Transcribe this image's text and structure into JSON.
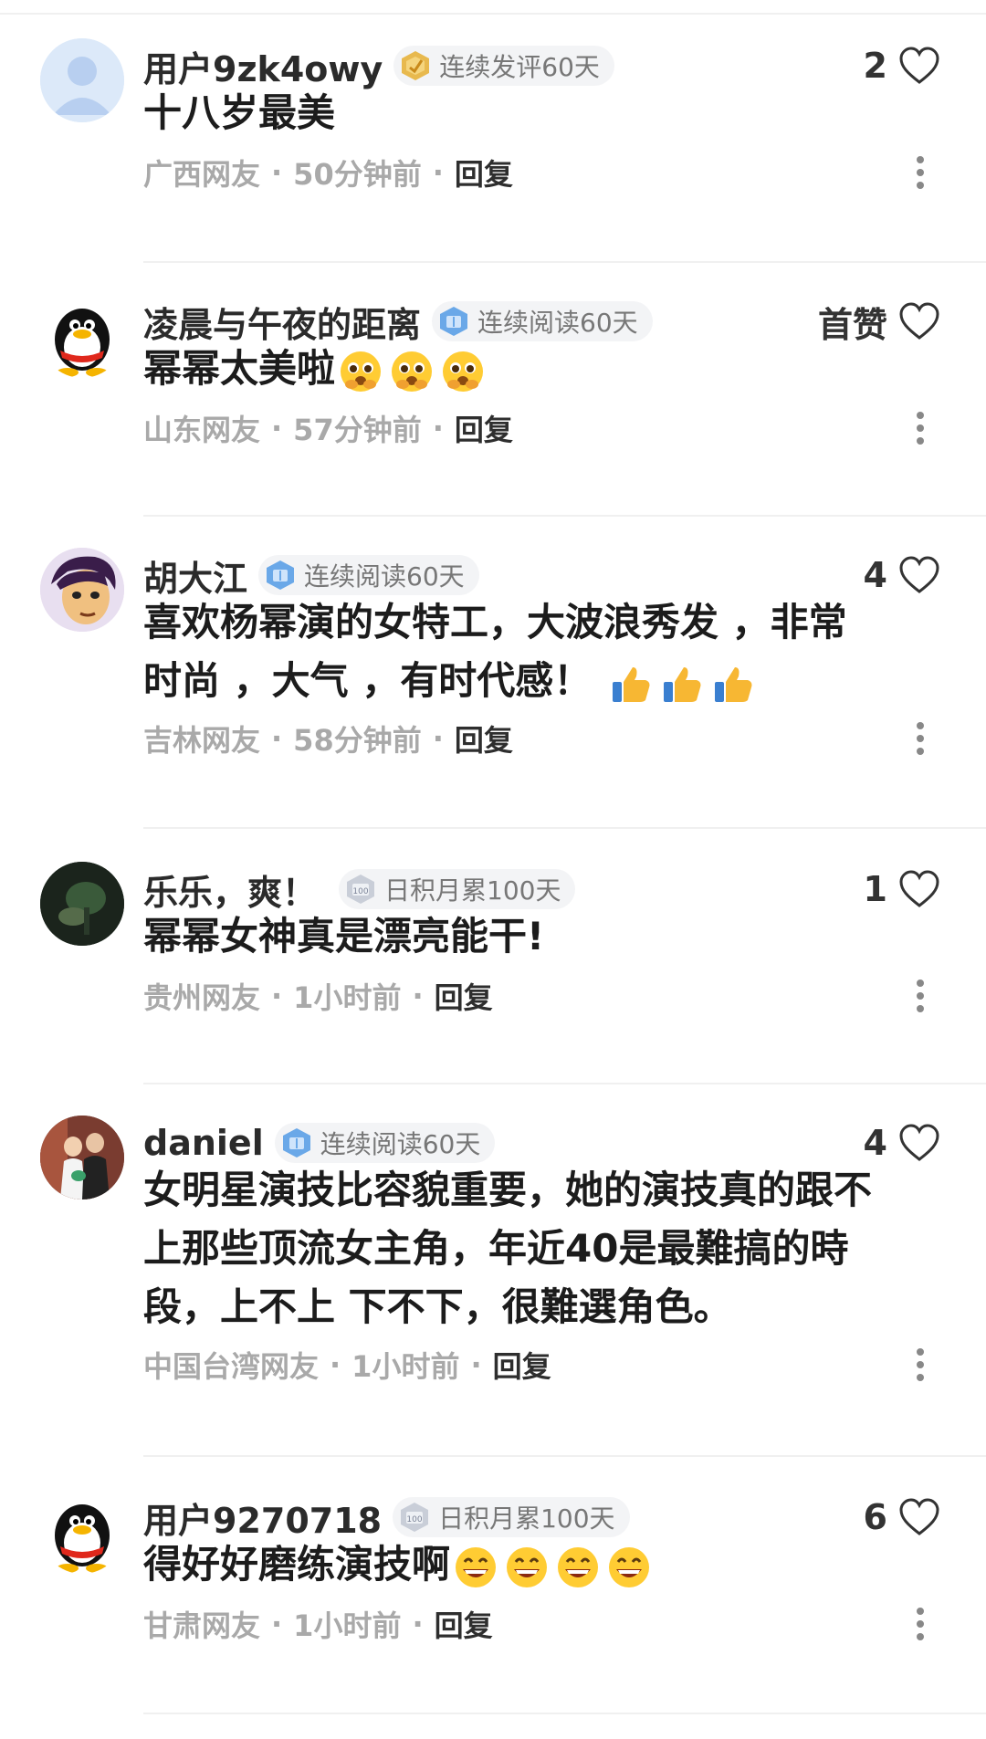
{
  "comments": [
    {
      "username": "用户9zk4owy",
      "badge": "连续发评60天",
      "badge_icon": "gold-medal-icon",
      "like_count": "2",
      "text": "十八岁最美",
      "emojis": [],
      "location": "广西网友",
      "time": "50分钟前",
      "reply": "回复",
      "avatar": "default-avatar"
    },
    {
      "username": "凌晨与午夜的距离",
      "badge": "连续阅读60天",
      "badge_icon": "blue-reading-badge-icon",
      "like_count": "首赞",
      "text": "幂幂太美啦",
      "emojis": [
        "pleading-face-emoji",
        "pleading-face-emoji",
        "pleading-face-emoji"
      ],
      "location": "山东网友",
      "time": "57分钟前",
      "reply": "回复",
      "avatar": "penguin-avatar"
    },
    {
      "username": "胡大江",
      "badge": "连续阅读60天",
      "badge_icon": "blue-reading-badge-icon",
      "like_count": "4",
      "text_lines": [
        "喜欢杨幂演的女特工，大波浪秀发 ，非常",
        "时尚 ，大气 ，有时代感！"
      ],
      "emojis": [
        "thumbs-up-emoji",
        "thumbs-up-emoji",
        "thumbs-up-emoji"
      ],
      "location": "吉林网友",
      "time": "58分钟前",
      "reply": "回复",
      "avatar": "cartoon-face-avatar"
    },
    {
      "username": "乐乐，爽！",
      "badge": "日积月累100天",
      "badge_icon": "silver-accumulate-badge-icon",
      "like_count": "1",
      "text": "幂幂女神真是漂亮能干!",
      "emojis": [],
      "location": "贵州网友",
      "time": "1小时前",
      "reply": "回复",
      "avatar": "dark-photo-avatar"
    },
    {
      "username": "daniel",
      "badge": "连续阅读60天",
      "badge_icon": "blue-reading-badge-icon",
      "like_count": "4",
      "text_lines": [
        "女明星演技比容貌重要，她的演技真的跟不",
        "上那些顶流女主角，年近40是最難搞的時",
        "段，上不上 下不下，很難選角色。"
      ],
      "emojis": [],
      "location": "中国台湾网友",
      "time": "1小时前",
      "reply": "回复",
      "avatar": "couple-photo-avatar"
    },
    {
      "username": "用户9270718",
      "badge": "日积月累100天",
      "badge_icon": "silver-accumulate-badge-icon",
      "like_count": "6",
      "text": "得好好磨练演技啊",
      "emojis": [
        "grinning-face-emoji",
        "grinning-face-emoji",
        "grinning-face-emoji",
        "grinning-face-emoji"
      ],
      "location": "甘肃网友",
      "time": "1小时前",
      "reply": "回复",
      "avatar": "penguin-avatar"
    }
  ],
  "colors": {
    "username": "#2b2b2b",
    "meta": "#a9a9a9",
    "divider": "#f0f0f0",
    "badge_bg": "#f3f4f6"
  }
}
